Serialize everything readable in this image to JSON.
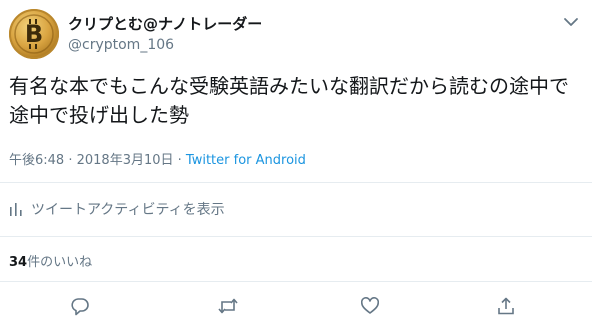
{
  "user": {
    "display_name": "クリプとむ@ナノトレーダー",
    "handle": "@cryptom_106",
    "avatar_icon": "bitcoin-icon"
  },
  "tweet": {
    "text": "有名な本でもこんな受験英語みたいな翻訳だから読むの途中で途中で投げ出した勢",
    "time": "午後6:48",
    "separator": " · ",
    "date": "2018年3月10日",
    "source": "Twitter for Android"
  },
  "activity": {
    "label": "ツイートアクティビティを表示",
    "icon": "bar-chart-icon"
  },
  "likes": {
    "count": "34",
    "label": "件のいいね"
  },
  "actions": {
    "reply_icon": "reply-icon",
    "retweet_icon": "retweet-icon",
    "like_icon": "heart-icon",
    "share_icon": "share-icon"
  },
  "colors": {
    "text": "#14171a",
    "secondary": "#657786",
    "link": "#1b95e0",
    "divider": "#e6ecf0"
  }
}
